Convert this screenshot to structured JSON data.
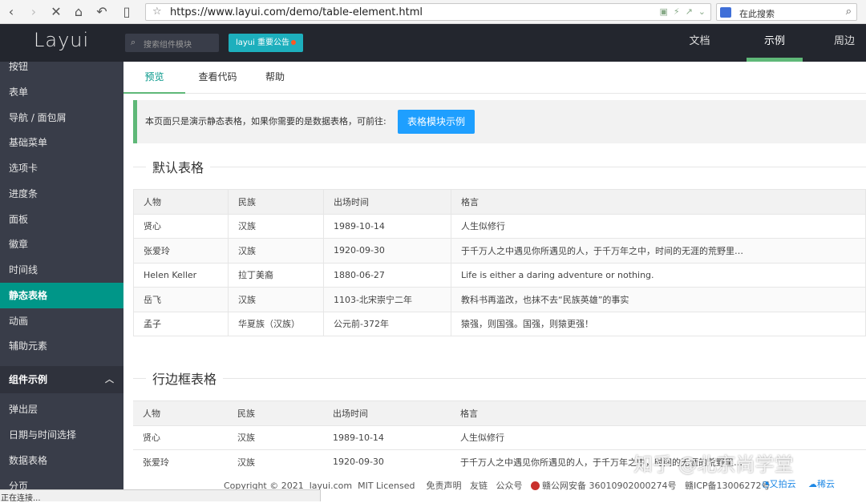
{
  "browser": {
    "url": "https://www.layui.com/demo/table-element.html",
    "search_placeholder": "在此搜索",
    "status": "正在连接..."
  },
  "header": {
    "logo": "Layui",
    "search_placeholder": "搜索组件模块",
    "notice_label": "layui 重要公告",
    "nav": [
      {
        "label": "文档",
        "active": false
      },
      {
        "label": "示例",
        "active": true
      },
      {
        "label": "周边",
        "active": false
      }
    ]
  },
  "sidebar": {
    "items": [
      "按钮",
      "表单",
      "导航 / 面包屑",
      "基础菜单",
      "选项卡",
      "进度条",
      "面板",
      "徽章",
      "时间线",
      "静态表格",
      "动画",
      "辅助元素"
    ],
    "active": "静态表格",
    "group_label": "组件示例",
    "group_items": [
      "弹出层",
      "日期与时间选择",
      "数据表格",
      "分页"
    ]
  },
  "tabs": [
    {
      "label": "预览",
      "active": true
    },
    {
      "label": "查看代码",
      "active": false
    },
    {
      "label": "帮助",
      "active": false
    }
  ],
  "quote": {
    "text": "本页面只是演示静态表格，如果你需要的是数据表格，可前往:",
    "button_label": "表格模块示例"
  },
  "table1": {
    "title": "默认表格",
    "headers": [
      "人物",
      "民族",
      "出场时间",
      "格言"
    ],
    "rows": [
      [
        "贤心",
        "汉族",
        "1989-10-14",
        "人生似修行"
      ],
      [
        "张爱玲",
        "汉族",
        "1920-09-30",
        "于千万人之中遇见你所遇见的人，于千万年之中，时间的无涯的荒野里…"
      ],
      [
        "Helen Keller",
        "拉丁美裔",
        "1880-06-27",
        "Life is either a daring adventure or nothing."
      ],
      [
        "岳飞",
        "汉族",
        "1103-北宋崇宁二年",
        "教科书再滥改，也抹不去“民族英雄”的事实"
      ],
      [
        "孟子",
        "华夏族（汉族）",
        "公元前-372年",
        "猿强，则国强。国强，则猿更强！"
      ]
    ]
  },
  "table2": {
    "title": "行边框表格",
    "headers": [
      "人物",
      "民族",
      "出场时间",
      "格言"
    ],
    "rows": [
      [
        "贤心",
        "汉族",
        "1989-10-14",
        "人生似修行"
      ],
      [
        "张爱玲",
        "汉族",
        "1920-09-30",
        "于千万人之中遇见你所遇见的人，于千万年之中，时间的无涯的荒野里…"
      ]
    ]
  },
  "footer": {
    "copyright": "Copyright © 2021",
    "site": "layui.com",
    "license": "MIT Licensed",
    "links": [
      "免责声明",
      "友链",
      "公众号"
    ],
    "police": "赣公网安备 36010902000274号",
    "icp": "赣ICP备13006272号",
    "sponsor1": "又拍云",
    "sponsor2": "稀云"
  },
  "watermark": "知乎 @北京尚学堂"
}
